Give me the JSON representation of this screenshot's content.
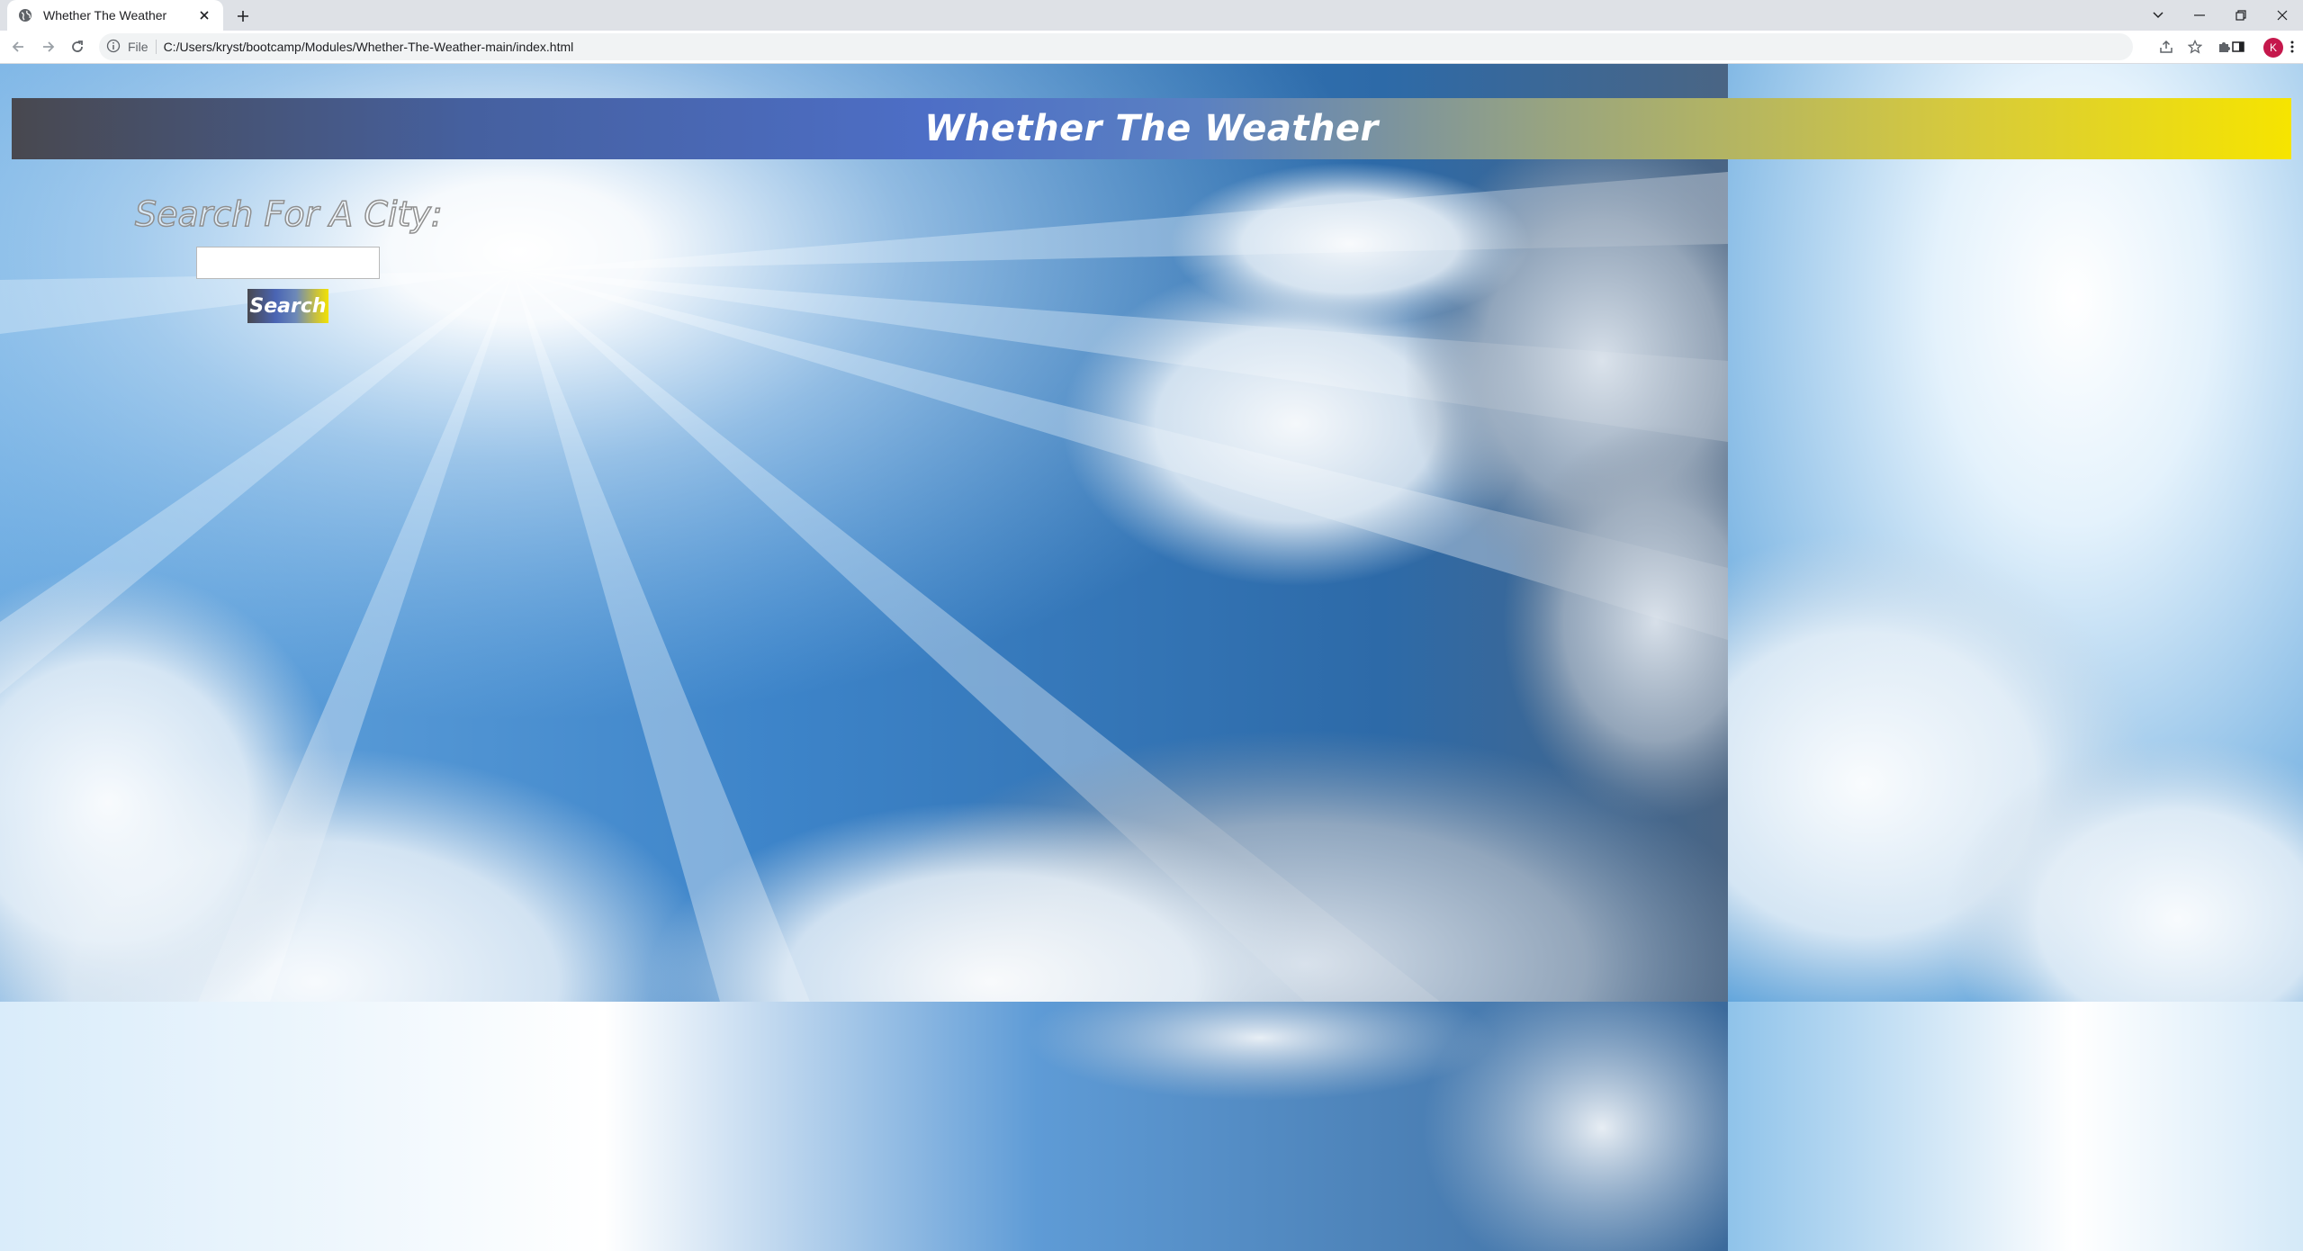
{
  "browser": {
    "tab_title": "Whether The Weather",
    "omnibox_scheme": "File",
    "url": "C:/Users/kryst/bootcamp/Modules/Whether-The-Weather-main/index.html",
    "profile_initial": "K"
  },
  "page": {
    "title": "Whether The Weather",
    "search_label": "Search For A City:",
    "search_input_value": "",
    "search_button_label": "Search"
  },
  "colors": {
    "header_gradient": [
      "#48484f",
      "#4d6ec6",
      "#f6e400"
    ],
    "sky": "#5b9ad8",
    "profile_avatar": "#c5184c"
  }
}
